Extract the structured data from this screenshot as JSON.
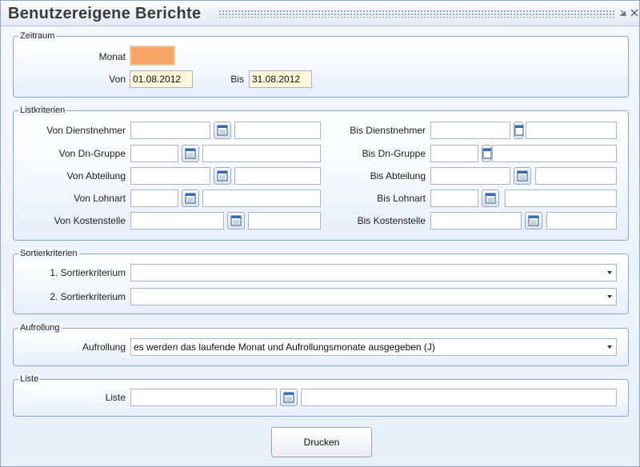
{
  "window": {
    "title": "Benutzereigene Berichte"
  },
  "zeitraum": {
    "legend": "Zeitraum",
    "monat_label": "Monat",
    "monat_value": "",
    "von_label": "Von",
    "von_value": "01.08.2012",
    "bis_label": "Bis",
    "bis_value": "31.08.2012"
  },
  "listkriterien": {
    "legend": "Listkriterien",
    "rows": [
      {
        "von_label": "Von Dienstnehmer",
        "bis_label": "Bis Dienstnehmer"
      },
      {
        "von_label": "Von Dn-Gruppe",
        "bis_label": "Bis Dn-Gruppe"
      },
      {
        "von_label": "Von Abteilung",
        "bis_label": "Bis Abteilung"
      },
      {
        "von_label": "Von Lohnart",
        "bis_label": "Bis Lohnart"
      },
      {
        "von_label": "Von Kostenstelle",
        "bis_label": "Bis Kostenstelle"
      }
    ]
  },
  "sortierkriterien": {
    "legend": "Sortierkriterien",
    "first_label": "1. Sortierkriterium",
    "first_value": "",
    "second_label": "2. Sortierkriterium",
    "second_value": ""
  },
  "aufrollung": {
    "legend": "Aufrollung",
    "label": "Aufrollung",
    "value": "es werden das laufende Monat und Aufrollungsmonate ausgegeben (J)"
  },
  "liste": {
    "legend": "Liste",
    "label": "Liste",
    "value": "",
    "description": ""
  },
  "actions": {
    "print_label": "Drucken"
  },
  "icons": {
    "calendar": "calendar-icon",
    "dropdown": "chevron-down-icon",
    "minimize": "minimize-icon",
    "close": "close-icon"
  }
}
